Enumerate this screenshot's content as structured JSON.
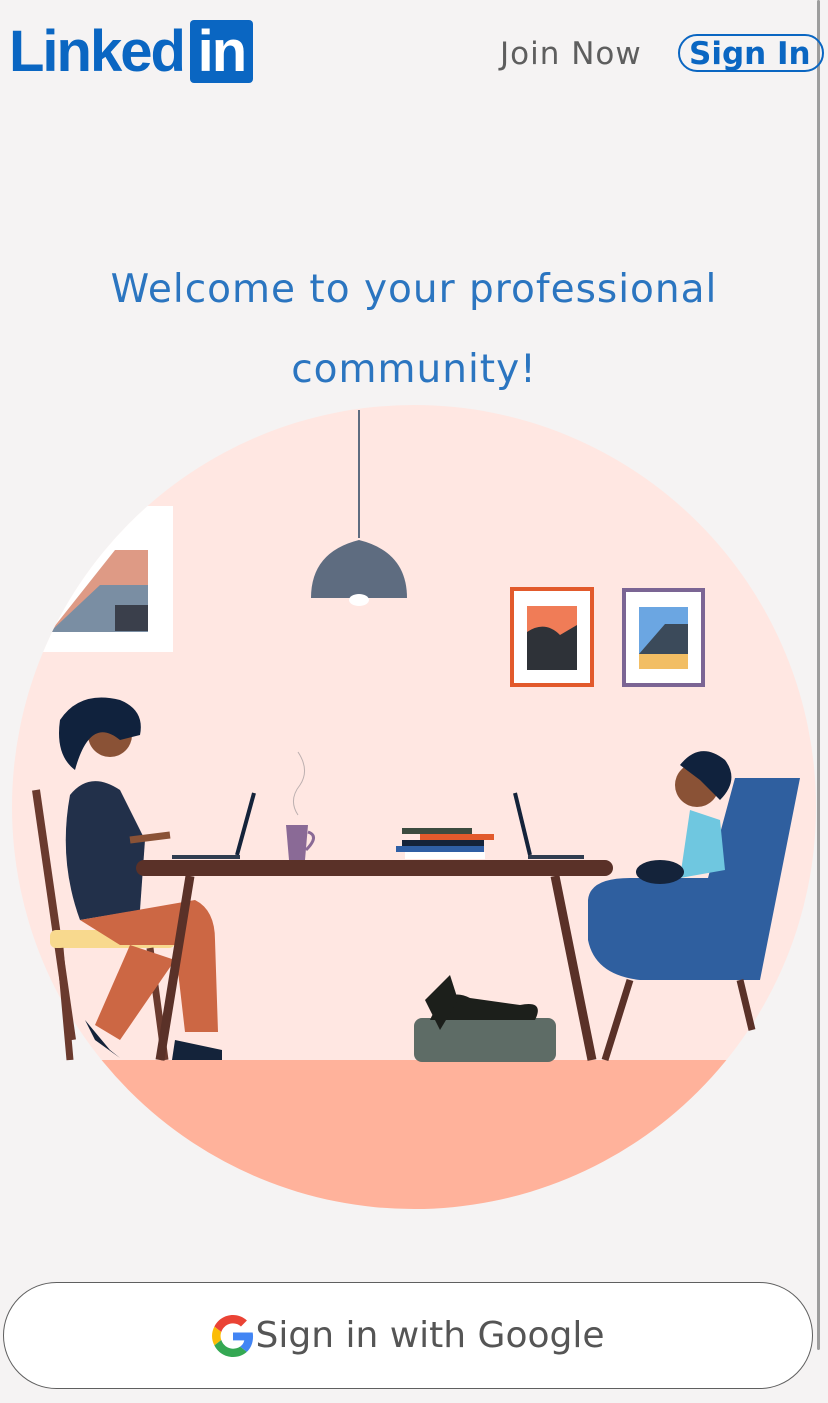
{
  "header": {
    "logo_text": "Linked",
    "logo_box_text": "in",
    "join_label": "Join Now",
    "signin_label": "Sign In"
  },
  "hero": {
    "line1": "Welcome to your professional",
    "line2": "community!"
  },
  "google_button": {
    "label": "Sign in with Google",
    "icon": "google-g-icon"
  },
  "colors": {
    "brand": "#0a66c2",
    "headline": "#2b75c0",
    "background": "#f5f3f3"
  }
}
